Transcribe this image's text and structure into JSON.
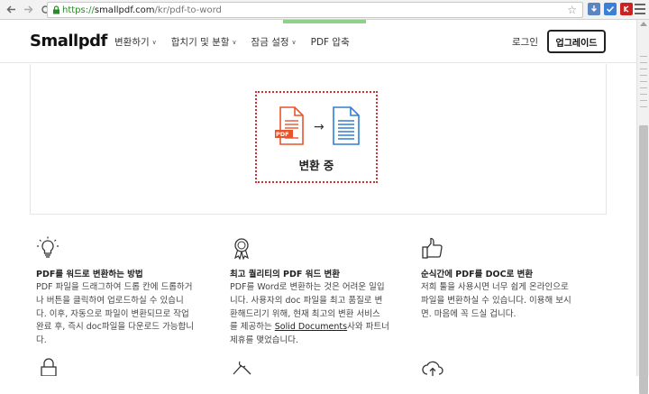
{
  "browser": {
    "url_scheme": "https://",
    "url_host": "smallpdf.com",
    "url_path": "/kr/pdf-to-word",
    "ext_colors": [
      "#6699cc",
      "#3b7fd9",
      "#cc2222"
    ],
    "ext_labels": [
      "",
      "",
      ""
    ]
  },
  "header": {
    "logo": "Smallpdf",
    "nav": [
      {
        "label": "변환하기"
      },
      {
        "label": "합치기 및 분할"
      },
      {
        "label": "잠금 설정"
      },
      {
        "label": "PDF 압축"
      }
    ],
    "login": "로그인",
    "upgrade": "업그레이드"
  },
  "converter": {
    "pdf_badge": "PDF",
    "arrow": "→",
    "status": "변환 중"
  },
  "features": [
    {
      "icon": "lightbulb-icon",
      "title": "PDF를 워드로 변환하는 방법",
      "lines": [
        "PDF 파일을 드래그하여 드롭 칸에 드롭하거",
        "나 버튼을 클릭하여 업로드하실 수 있습니",
        "다. 이후, 자동으로 파일이 변환되므로 작업",
        "완료 후, 즉시 doc파일을 다운로드 가능합니",
        "다."
      ]
    },
    {
      "icon": "award-ribbon-icon",
      "title": "최고 퀄리티의 PDF 워드 변환",
      "lines": [
        "PDF를 Word로 변환하는 것은 어려운 일입",
        "니다. 사용자의 doc 파일을 최고 품질로 변",
        "환해드리기 위해, 현재 최고의 변환 서비스",
        "를 제공하는 ",
        "사와 파트너",
        "제휴를 맺었습니다."
      ],
      "link": "Solid Documents"
    },
    {
      "icon": "thumbs-up-icon",
      "title": "순식간에 PDF를 DOC로 변환",
      "lines": [
        "저희 툴을 사용시면 너무 쉽게 온라인으로",
        "파일을 변환하실 수 있습니다. 이용해 보시",
        "면. 마음에 꼭 드실 겁니다."
      ]
    }
  ]
}
